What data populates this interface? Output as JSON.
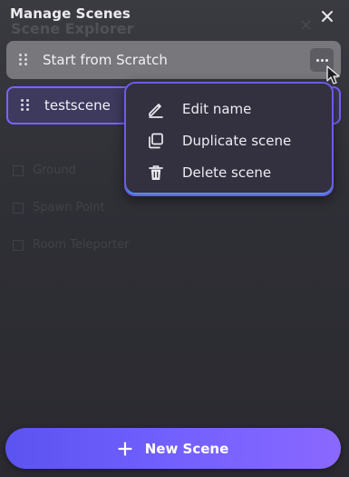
{
  "header": {
    "title": "Manage Scenes",
    "close_icon": "close-icon"
  },
  "background_ghost": {
    "title": "Scene Explorer",
    "items": [
      "Ground",
      "Spawn Point",
      "Room Teleporter"
    ]
  },
  "scenes": [
    {
      "name": "Start from Scratch",
      "state": "hovered",
      "drag_icon": "drag-handle-icon",
      "more_icon": "more-horizontal-icon"
    },
    {
      "name": "testscene",
      "state": "selected",
      "drag_icon": "drag-handle-icon"
    }
  ],
  "context_menu": {
    "items": [
      {
        "label": "Edit name",
        "icon": "pencil-icon"
      },
      {
        "label": "Duplicate scene",
        "icon": "duplicate-icon"
      },
      {
        "label": "Delete scene",
        "icon": "trash-icon"
      }
    ]
  },
  "footer": {
    "new_scene_label": "New Scene",
    "new_scene_icon": "plus-icon"
  },
  "colors": {
    "accent": "#7260ff",
    "selected_border": "#7b63ff",
    "hover_row": "#77777c",
    "panel_bg": "#323238"
  }
}
